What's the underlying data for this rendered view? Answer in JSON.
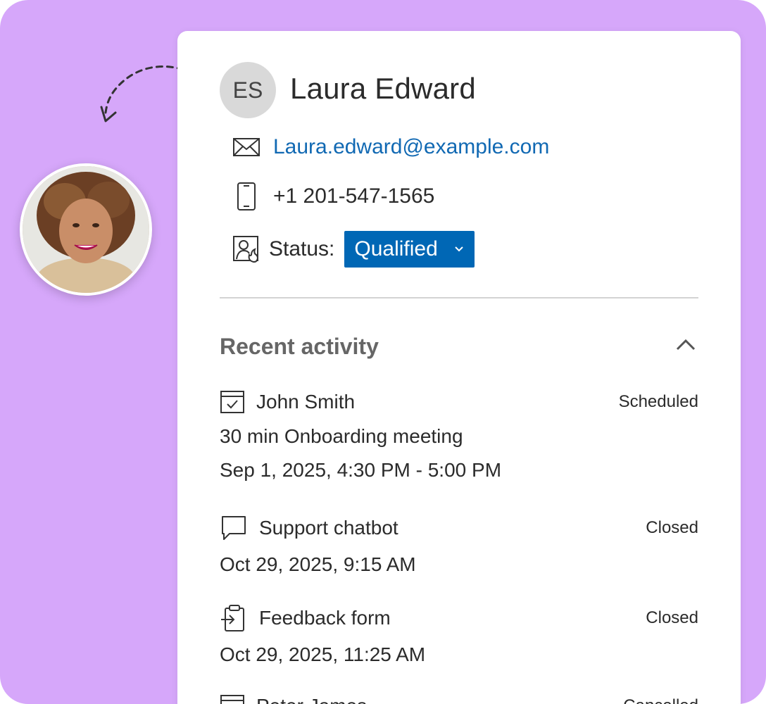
{
  "contact": {
    "initials": "ES",
    "name": "Laura Edward",
    "email": "Laura.edward@example.com",
    "phone": "+1 201-547-1565",
    "status_label": "Status:",
    "status_value": "Qualified"
  },
  "section": {
    "title": "Recent activity"
  },
  "activities": [
    {
      "icon": "calendar-check-icon",
      "title": "John Smith",
      "state": "Scheduled",
      "lines": [
        "30 min Onboarding meeting",
        "Sep 1, 2025, 4:30 PM - 5:00 PM"
      ]
    },
    {
      "icon": "chat-bubble-icon",
      "title": "Support chatbot",
      "state": "Closed",
      "lines": [
        "Oct 29, 2025, 9:15 AM"
      ]
    },
    {
      "icon": "clipboard-form-icon",
      "title": "Feedback form",
      "state": "Closed",
      "lines": [
        "Oct 29, 2025, 11:25 AM"
      ]
    },
    {
      "icon": "calendar-icon",
      "title": "Peter James",
      "state": "Cancelled",
      "lines": []
    }
  ],
  "colors": {
    "background": "#d6a7fa",
    "accent": "#0067b5",
    "link": "#1169b3"
  }
}
